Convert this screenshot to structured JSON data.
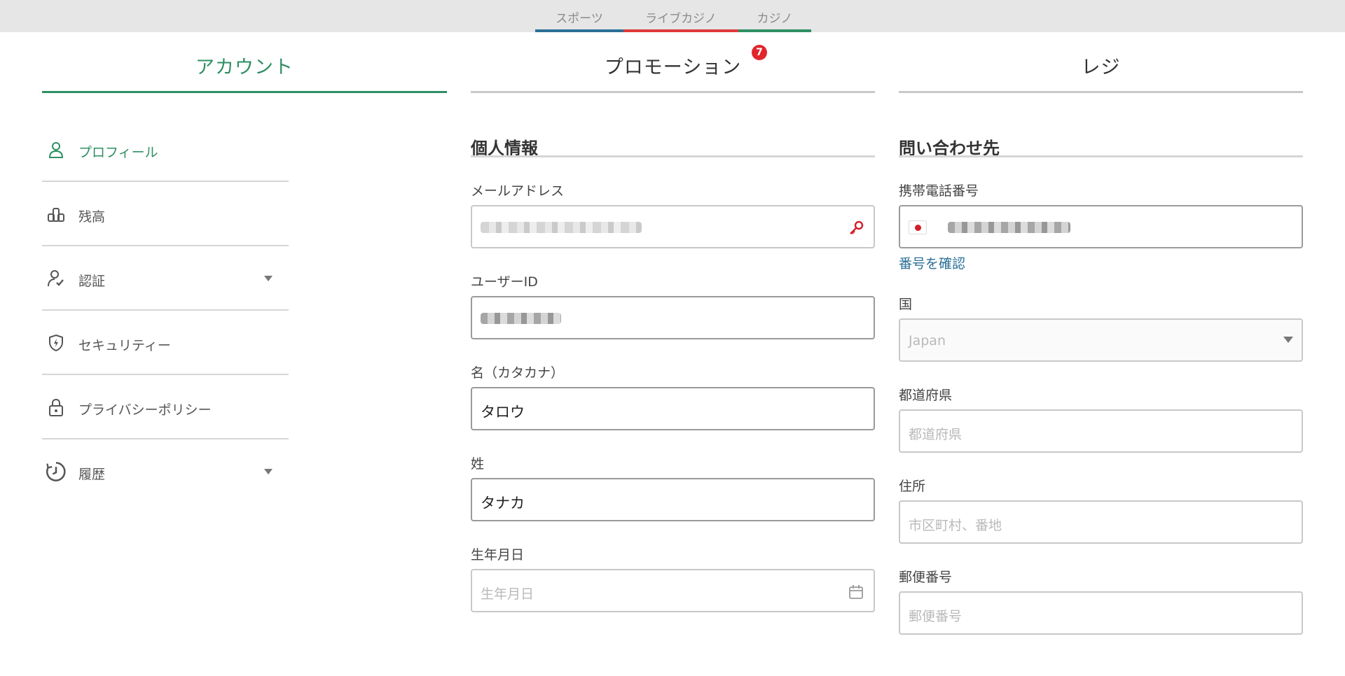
{
  "product_tabs": [
    {
      "label": "スポーツ",
      "color": "#2b6f97"
    },
    {
      "label": "ライブカジノ",
      "color": "#e03a3a"
    },
    {
      "label": "カジノ",
      "color": "#2e8f63"
    }
  ],
  "main_tabs": {
    "account": "アカウント",
    "promotion": "プロモーション",
    "promotion_badge": "7",
    "register": "レジ"
  },
  "sidebar": {
    "items": [
      {
        "label": "プロフィール",
        "icon": "user-icon",
        "active": true
      },
      {
        "label": "残高",
        "icon": "coins-icon"
      },
      {
        "label": "認証",
        "icon": "verified-user-icon",
        "expandable": true
      },
      {
        "label": "セキュリティー",
        "icon": "shield-icon"
      },
      {
        "label": "プライバシーポリシー",
        "icon": "lock-icon"
      },
      {
        "label": "履歴",
        "icon": "history-icon",
        "expandable": true
      }
    ]
  },
  "personal": {
    "title": "個人情報",
    "email_label": "メールアドレス",
    "email_value": "",
    "userid_label": "ユーザーID",
    "userid_value": "",
    "firstname_label": "名（カタカナ）",
    "firstname_value": "タロウ",
    "lastname_label": "姓",
    "lastname_value": "タナカ",
    "dob_label": "生年月日",
    "dob_placeholder": "生年月日"
  },
  "contact": {
    "title": "問い合わせ先",
    "phone_label": "携帯電話番号",
    "phone_value": "",
    "verify_link": "番号を確認",
    "country_label": "国",
    "country_value": "Japan",
    "prefecture_label": "都道府県",
    "prefecture_placeholder": "都道府県",
    "address_label": "住所",
    "address_placeholder": "市区町村、番地",
    "postal_label": "郵便番号",
    "postal_placeholder": "郵便番号"
  },
  "colors": {
    "accent": "#2e8f63",
    "link": "#2b6f97",
    "badge": "#e0262b"
  }
}
